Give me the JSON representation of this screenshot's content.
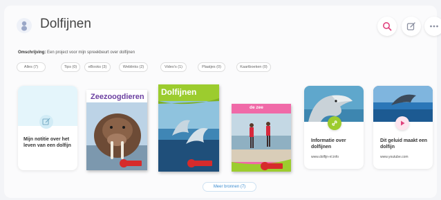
{
  "header": {
    "title": "Dolfijnen",
    "buttons": [
      {
        "name": "search-button",
        "icon": "search-icon"
      },
      {
        "name": "edit-button",
        "icon": "edit-icon"
      },
      {
        "name": "more-options-button",
        "icon": "more-icon"
      }
    ]
  },
  "description": {
    "label": "Omschrijving:",
    "text": "Een project voor mijn spreekbeurt over dolfijnen"
  },
  "filters": [
    {
      "label": "Alles (7)"
    },
    {
      "label": "Tips (0)"
    },
    {
      "label": "eBooks (3)"
    },
    {
      "label": "Weblinks (2)"
    },
    {
      "label": "Video's (1)"
    },
    {
      "label": "Plaatjes (0)"
    },
    {
      "label": "Kaartboeken (0)"
    }
  ],
  "items": {
    "note": {
      "title": "Mijn notitie over het leven van een dolfijn",
      "icon": "note-icon"
    },
    "book1": {
      "title": "Zeezoogdieren",
      "cover_color": "#ffffff",
      "title_color": "#6b3fa0"
    },
    "book2": {
      "title": "Dolfijnen",
      "cover_color": "#9ccc2e",
      "title_color": "#ffffff"
    },
    "book3": {
      "title": "de zee",
      "cover_color": "#f06aa8",
      "title_color": "#ffffff"
    },
    "web1": {
      "title": "Informatie over dolfijnen",
      "url": "www.dolfijn-nl.info",
      "icon": "link-icon"
    },
    "web2": {
      "title": "Dit geluid maakt een dolfijn",
      "url": "www.youtube.com",
      "icon": "play-icon"
    }
  },
  "more_button": {
    "label": "Meer bronnen (7)"
  },
  "colors": {
    "accent_pink": "#e0437e",
    "accent_green": "#9ccc2e",
    "link_blue": "#3b8cd0"
  }
}
